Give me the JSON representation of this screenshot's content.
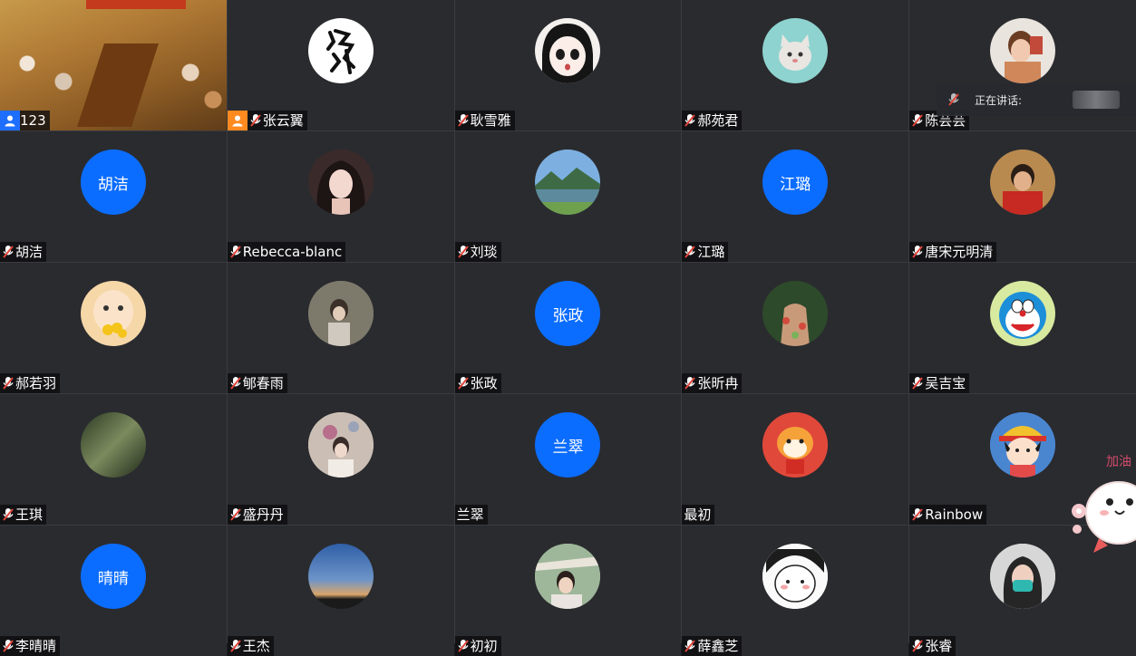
{
  "speaking_indicator": {
    "label": "正在讲话:",
    "icon": "muted-mic-icon"
  },
  "sticker": {
    "icon": "cartoon-sticker-icon",
    "text": "加油"
  },
  "colors": {
    "tile_background": "#2a2b2f",
    "grid_gap": "#3a3b3f",
    "name_avatar_blue": "#0b6dff",
    "muted_mic_red": "#e0453a",
    "host_badge_blue": "#1f6fff",
    "host_badge_orange": "#ff8a1f"
  },
  "participants": [
    {
      "name": "123",
      "avatar": "conference-room-video",
      "mic": "none",
      "badge": "user-icon-blue"
    },
    {
      "name": "张云翼",
      "avatar": "calligraphy-avatar",
      "mic": "muted",
      "badge": "user-icon-orange"
    },
    {
      "name": "耿雪雅",
      "avatar": "anime-girl-avatar",
      "mic": "muted"
    },
    {
      "name": "郝苑君",
      "avatar": "cat-avatar",
      "mic": "muted"
    },
    {
      "name": "陈芸芸",
      "avatar": "girl-photo-avatar",
      "mic": "muted"
    },
    {
      "name": "胡洁",
      "avatar_text": "胡洁",
      "mic": "muted"
    },
    {
      "name": "Rebecca-blanc",
      "avatar": "illustrated-woman-avatar",
      "mic": "muted"
    },
    {
      "name": "刘琰",
      "avatar": "mountain-landscape-avatar",
      "mic": "muted"
    },
    {
      "name": "江璐",
      "avatar_text": "江璐",
      "mic": "muted"
    },
    {
      "name": "唐宋元明清",
      "avatar": "child-red-shirt-avatar",
      "mic": "muted"
    },
    {
      "name": "郝若羽",
      "avatar": "baby-flowers-avatar",
      "mic": "muted"
    },
    {
      "name": "郇春雨",
      "avatar": "girl-outdoor-avatar",
      "mic": "muted"
    },
    {
      "name": "张政",
      "avatar_text": "张政",
      "mic": "muted"
    },
    {
      "name": "张昕冉",
      "avatar": "floral-dress-avatar",
      "mic": "muted"
    },
    {
      "name": "吴吉宝",
      "avatar": "doraemon-avatar",
      "mic": "muted"
    },
    {
      "name": "王琪",
      "avatar": "blurred-foliage-avatar",
      "mic": "muted"
    },
    {
      "name": "盛丹丹",
      "avatar": "girl-flowers-avatar",
      "mic": "muted"
    },
    {
      "name": "兰翠",
      "avatar_text": "兰翠",
      "mic": "none"
    },
    {
      "name": "最初",
      "avatar": "tiger-cartoon-avatar",
      "mic": "none"
    },
    {
      "name": "Rainbow",
      "avatar": "maruko-cartoon-avatar",
      "mic": "muted"
    },
    {
      "name": "李晴晴",
      "avatar_text": "晴晴",
      "mic": "muted"
    },
    {
      "name": "王杰",
      "avatar": "night-sky-avatar",
      "mic": "muted"
    },
    {
      "name": "初初",
      "avatar": "girl-sunlight-avatar",
      "mic": "muted"
    },
    {
      "name": "薛鑫芝",
      "avatar": "cute-blob-avatar",
      "mic": "muted"
    },
    {
      "name": "张睿",
      "avatar": "woman-mask-avatar",
      "mic": "muted"
    }
  ]
}
